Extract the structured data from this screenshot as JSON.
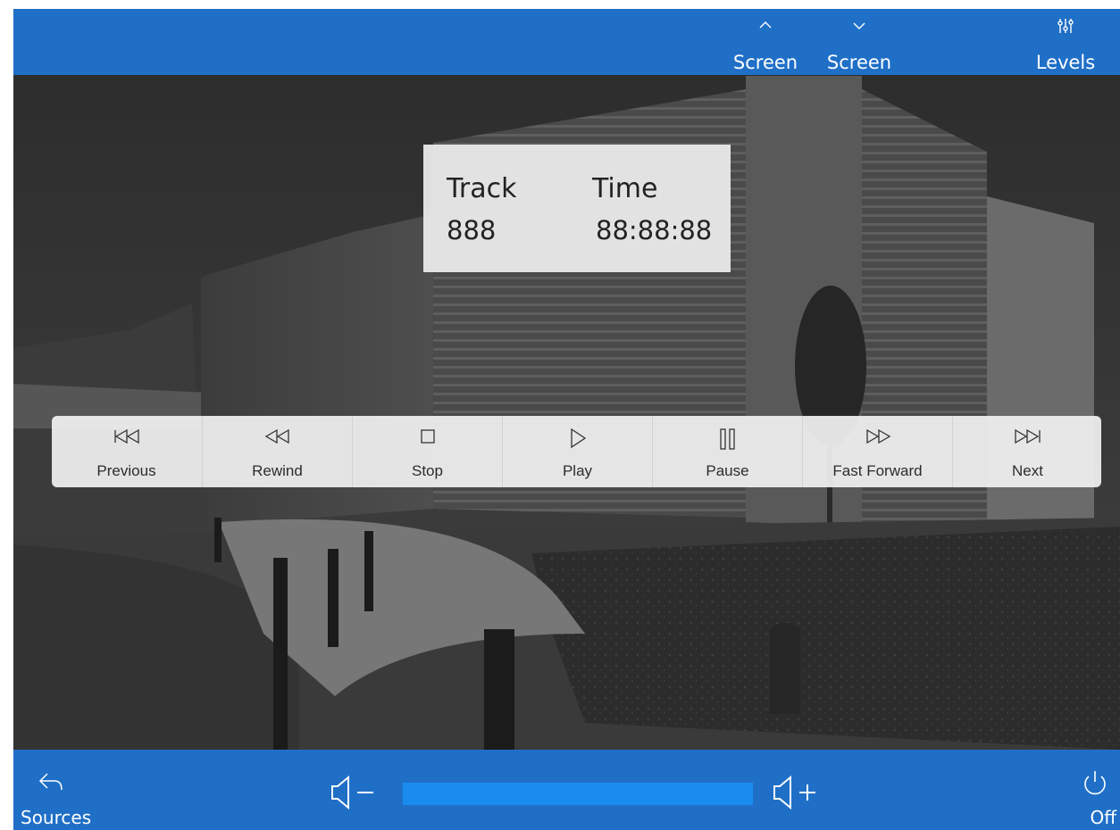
{
  "header": {
    "screen_up_label": "Screen",
    "screen_down_label": "Screen",
    "levels_label": "Levels"
  },
  "now_playing": {
    "track_label": "Track",
    "time_label": "Time",
    "track_value": "888",
    "time_value": "88:88:88"
  },
  "transport": {
    "previous_label": "Previous",
    "rewind_label": "Rewind",
    "stop_label": "Stop",
    "play_label": "Play",
    "pause_label": "Pause",
    "fast_forward_label": "Fast Forward",
    "next_label": "Next"
  },
  "footer": {
    "sources_label": "Sources",
    "off_label": "Off",
    "volume_level": 1.0
  },
  "colors": {
    "bar_blue": "#1f6fc7",
    "volume_fill": "#1a8cf0",
    "panel_bg": "#efefef"
  }
}
